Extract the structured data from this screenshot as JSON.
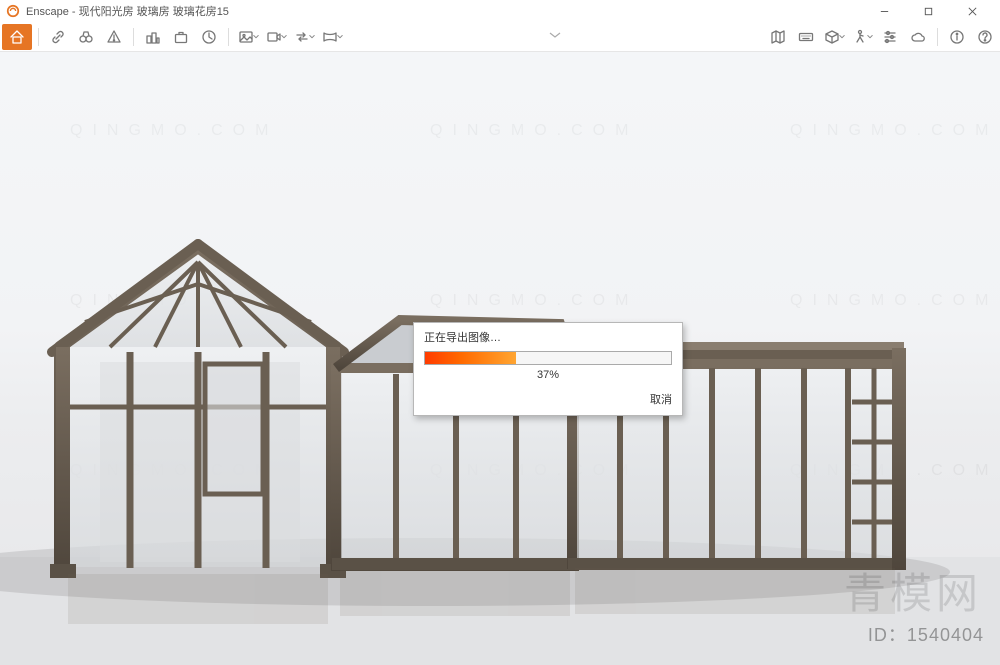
{
  "window": {
    "title": "Enscape - 现代阳光房 玻璃房 玻璃花房15"
  },
  "toolbar": {
    "home": "Home",
    "left_group": [
      "link-icon",
      "binoculars-icon",
      "warning-icon"
    ],
    "mid_group": [
      "town-icon",
      "suitcase-icon",
      "clock-icon"
    ],
    "export_group": [
      "image-export-icon",
      "video-export-icon",
      "swap-icon",
      "panorama-icon"
    ],
    "right_group": [
      "map-icon",
      "keyboard-icon",
      "cube-icon",
      "walk-icon",
      "sliders-icon",
      "cloud-icon",
      "info-icon",
      "help-icon"
    ]
  },
  "dialog": {
    "title": "正在导出图像…",
    "percent_text": "37%",
    "percent_value": 37,
    "cancel": "取消"
  },
  "watermark": {
    "text": "QINGMO.COM",
    "brand_cn": "青模网",
    "id_label": "ID：1540404"
  },
  "colors": {
    "accent": "#e67524",
    "progress_start": "#ff3b00",
    "progress_end": "#ffa531"
  }
}
